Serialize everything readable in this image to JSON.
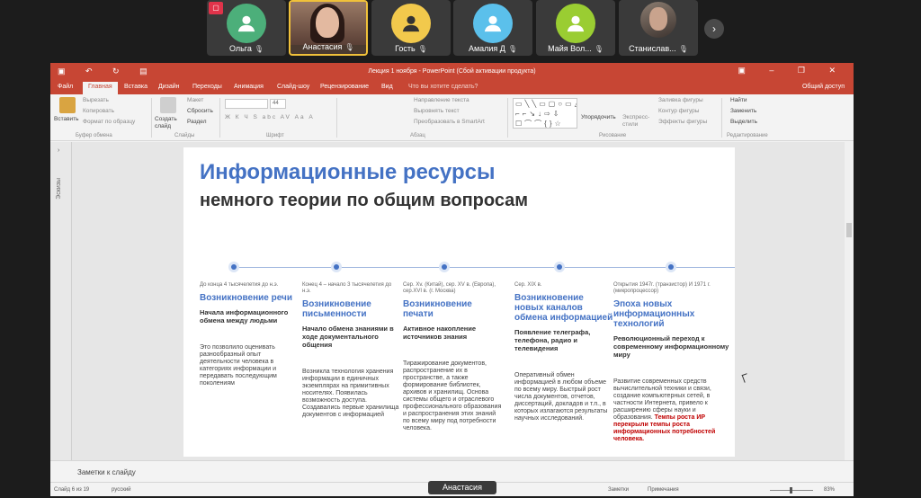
{
  "participants": [
    {
      "name": "Ольга",
      "avatar_color": "#4caf7a",
      "recording": true
    },
    {
      "name": "Анастасия",
      "avatar_color": "#000000",
      "active": true
    },
    {
      "name": "Гость",
      "avatar_color": "#f2c94c"
    },
    {
      "name": "Амалия Д",
      "avatar_color": "#5bc0eb"
    },
    {
      "name": "Майя Вол...",
      "avatar_color": "#9acd32"
    },
    {
      "name": "Станислав...",
      "avatar_color": "#333333"
    }
  ],
  "next_icon": "›",
  "rec_icon": "▢",
  "mic_off_icon": "🎙",
  "app": {
    "title": "Лекция 1 ноября - PowerPoint (Сбой активации продукта)",
    "quick_access": "▣ ↶ ↻ ▤",
    "window_controls": "▣ – ❐ ✕",
    "tabs": [
      "Файл",
      "Главная",
      "Вставка",
      "Дизайн",
      "Переходы",
      "Анимация",
      "Слайд-шоу",
      "Рецензирование",
      "Вид"
    ],
    "tell_me": "Что вы хотите сделать?",
    "share": "Общий доступ"
  },
  "ribbon": {
    "paste": "Вставить",
    "cut": "Вырезать",
    "copy": "Копировать",
    "format_painter": "Формат по образцу",
    "clipboard_group": "Буфер обмена",
    "new_slide": "Создать слайд",
    "layout": "Макет",
    "reset": "Сбросить",
    "section": "Раздел",
    "slides_group": "Слайды",
    "font_size": "44",
    "font_group": "Шрифт",
    "font_buttons": "Ж К Ч S abc AV Аа A",
    "text_direction": "Направление текста",
    "align_text": "Выровнять текст",
    "smartart": "Преобразовать в SmartArt",
    "paragraph_group": "Абзац",
    "arrange": "Упорядочить",
    "quick_styles": "Экспресс-стили",
    "shape_fill": "Заливка фигуры",
    "shape_outline": "Контур фигуры",
    "shape_effects": "Эффекты фигуры",
    "drawing_group": "Рисование",
    "find": "Найти",
    "replace": "Заменить",
    "select": "Выделить",
    "editing_group": "Редактирование",
    "shapes_gallery": "▭╲╲▭▢○▭△ ⌐⌐↘↓⇨⇩ ☐⌒⌒{}☆"
  },
  "left_pane_label": "Эскизы",
  "left_pane_arrow": "›",
  "slide": {
    "title": "Информационные ресурсы",
    "subtitle": "немного теории по общим вопросам",
    "columns": [
      {
        "date": "До конца 4 тысячелетия до н.э.",
        "heading": "Возникновение речи",
        "sub": "Начала информационного обмена между людьми",
        "body": "Это позволило оценивать разнообразный опыт деятельности человека в категориях информации и передавать последующим поколениям",
        "body_red": ""
      },
      {
        "date": "Конец 4 – начало 3 тысячелетия до н.э.",
        "heading": "Возникновение письменности",
        "sub": "Начало обмена знаниями в ходе документального общения",
        "body": "Возникла технология хранения информации в единичных экземплярах на примитивных носителях. Появилась возможность доступа. Создавались первые хранилища документов с информацией",
        "body_red": ""
      },
      {
        "date": "Сер. Xv. (Китай), сер. XV в. (Европа), сер.XVI в. (г. Москва)",
        "heading": "Возникновение печати",
        "sub": "Активное накопление источников знания",
        "body": "Тиражирование документов, распространение их в пространстве, а также формирование библиотек, архивов и хранилищ. Основа системы общего и отраслевого профессионального образования и распространения этих знаний по всему миру под потребности человека.",
        "body_red": ""
      },
      {
        "date": "Сер. XIX в.",
        "heading": "Возникновение новых каналов обмена информацией",
        "sub": "Появление телеграфа, телефона, радио и телевидения",
        "body": "Оперативный обмен информацией в любом объеме по всему миру. Быстрый рост числа документов, отчетов, диссертаций, докладов и т.п., в которых излагаются результаты научных исследований.",
        "body_red": ""
      },
      {
        "date": "Открытия 1947г. (транзистор) И 1971 г. (микропроцессор)",
        "heading": "Эпоха новых информационных технологий",
        "sub": "Революционный переход к современному информационному миру",
        "body": "Развитие современных средств вычислительной техники и связи, создание компьютерных сетей, в частности Интернета, привело к расширению сферы науки и образования.",
        "body_red": "Темпы роста ИР перекрыли темпы роста информационных потребностей человека."
      }
    ]
  },
  "notes_label": "Заметки к слайду",
  "status": {
    "slide_of": "Слайд 6 из 19",
    "language": "русский",
    "notes": "Заметки",
    "comments": "Примечания",
    "zoom": "83%"
  },
  "presenter_label": "Анастасия"
}
